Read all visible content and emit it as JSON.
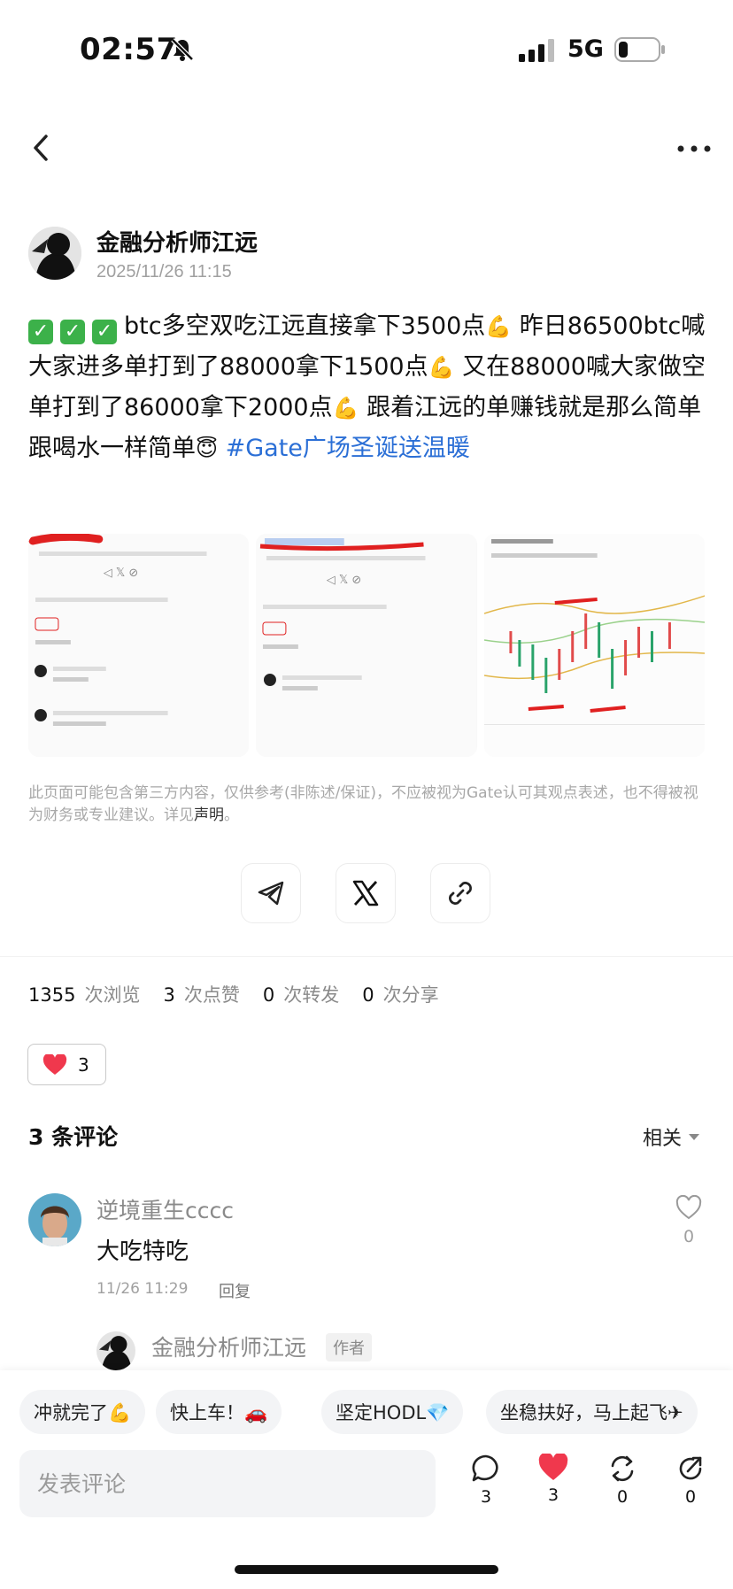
{
  "status_bar": {
    "time": "02:57",
    "network": "5G"
  },
  "author": {
    "name": "金融分析师江远",
    "time": "2025/11/26 11:15"
  },
  "post": {
    "checks": [
      "✓",
      "✓",
      "✓"
    ],
    "seg1": "btc多空双吃江远直接拿下3500点",
    "seg2": " 昨日86500btc喊大家进多单打到了88000拿下1500点",
    "seg3": " 又在88000喊大家做空单打到了86000拿下2000点",
    "seg4": " 跟着江远的单赚钱就是那么简单跟喝水一样简单",
    "emoji_flex": "💪",
    "emoji_halo": "😇",
    "hashtag": " #Gate广场圣诞送温暖"
  },
  "disclaimer": {
    "text": "此页面可能包含第三方内容，仅供参考(非陈述/保证)，不应被视为Gate认可其观点表述，也不得被视为财务或专业建议。详见",
    "link": "声明",
    "end": "。"
  },
  "stats": {
    "views": "1355",
    "views_label": "次浏览",
    "likes": "3",
    "likes_label": "次点赞",
    "reposts": "0",
    "reposts_label": "次转发",
    "shares": "0",
    "shares_label": "次分享"
  },
  "like_chip": {
    "count": "3"
  },
  "comments": {
    "title": "3 条评论",
    "sort": "相关",
    "first": {
      "user": "逆境重生cccc",
      "text": "大吃特吃",
      "time": "11/26 11:29",
      "reply": "回复",
      "likes": "0"
    },
    "reply": {
      "user": "金融分析师江远",
      "badge": "作者"
    }
  },
  "quick_replies": [
    "冲就完了💪",
    "快上车！🚗",
    "坚定HODL💎",
    "坐稳扶好，马上起飞✈"
  ],
  "composer": {
    "placeholder": "发表评论"
  },
  "actions": {
    "comments": "3",
    "likes": "3",
    "reposts": "0",
    "shares": "0"
  },
  "colors": {
    "accent_blue": "#2b6fd6",
    "heart_red": "#f0384d",
    "check_green": "#3cb14a"
  }
}
